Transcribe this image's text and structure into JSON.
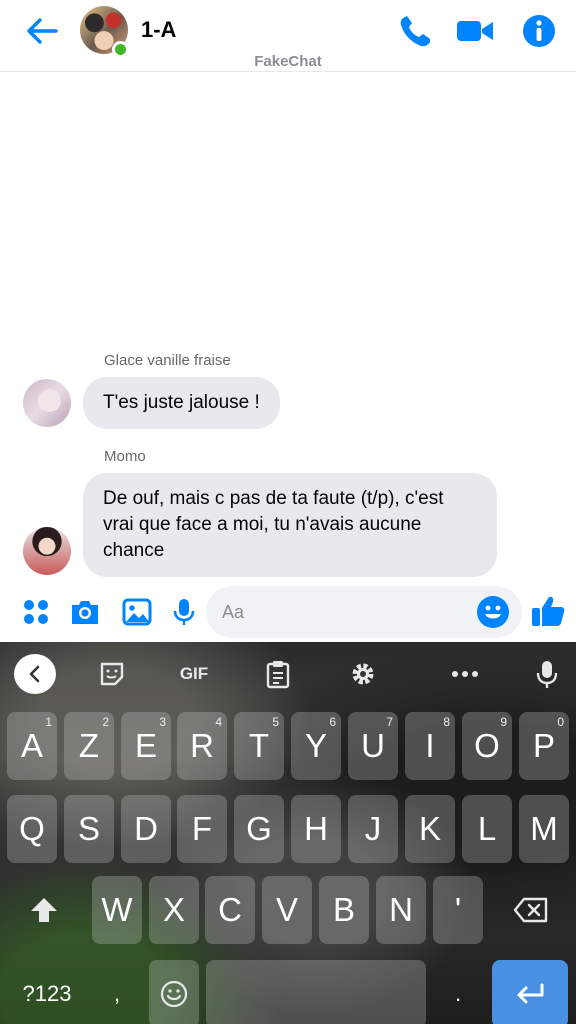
{
  "header": {
    "title": "1-A",
    "watermark": "FakeChat",
    "online": true
  },
  "messages": [
    {
      "sender": "Glace vanille fraise",
      "text": "T'es juste jalouse !"
    },
    {
      "sender": "Momo",
      "text": "De ouf, mais c pas de ta faute (t/p), c'est vrai que face a moi, tu n'avais aucune chance"
    }
  ],
  "composer": {
    "placeholder": "Aa"
  },
  "keyboard": {
    "toolbar_gif": "GIF",
    "row1": [
      "A",
      "Z",
      "E",
      "R",
      "T",
      "Y",
      "U",
      "I",
      "O",
      "P"
    ],
    "row1_hints": [
      "1",
      "2",
      "3",
      "4",
      "5",
      "6",
      "7",
      "8",
      "9",
      "0"
    ],
    "row2": [
      "Q",
      "S",
      "D",
      "F",
      "G",
      "H",
      "J",
      "K",
      "L",
      "M"
    ],
    "row3": [
      "W",
      "X",
      "C",
      "V",
      "B",
      "N",
      "'"
    ],
    "symbols_label": "?123",
    "comma": ",",
    "period": "."
  },
  "colors": {
    "accent": "#0084ff",
    "bubble": "#e9e9ed",
    "online": "#42b72a",
    "enter_key": "#4a90e2"
  }
}
